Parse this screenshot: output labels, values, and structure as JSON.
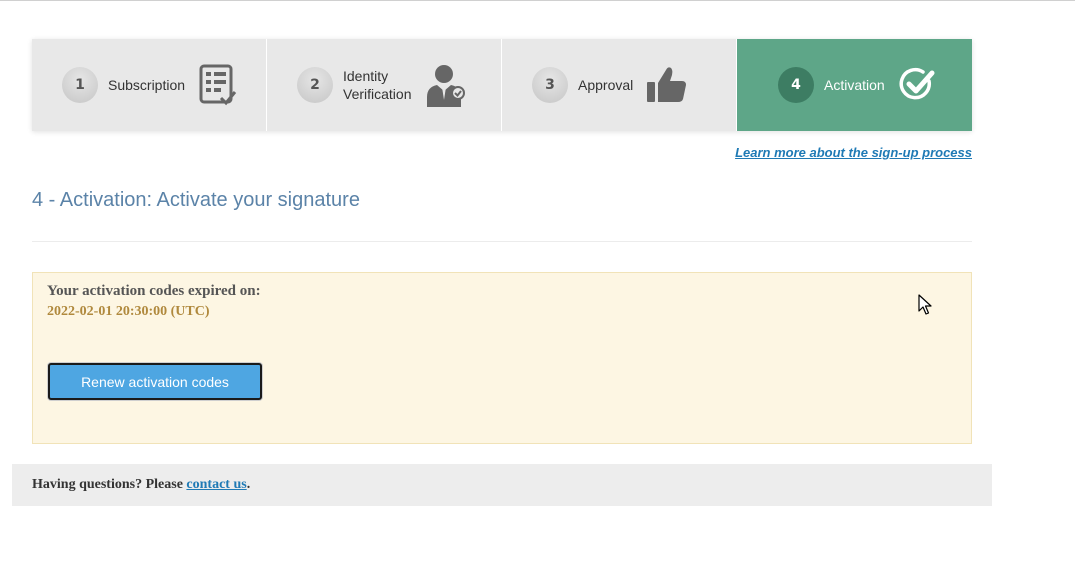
{
  "steps": [
    {
      "number": "1",
      "label": "Subscription",
      "icon": "checklist-icon"
    },
    {
      "number": "2",
      "label_line1": "Identity",
      "label_line2": "Verification",
      "icon": "verified-user-icon"
    },
    {
      "number": "3",
      "label": "Approval",
      "icon": "thumbs-up-icon"
    },
    {
      "number": "4",
      "label": "Activation",
      "icon": "check-circle-icon",
      "active": true
    }
  ],
  "links": {
    "learn_more": "Learn more about the sign-up process"
  },
  "page": {
    "title": "4 - Activation: Activate your signature"
  },
  "notice": {
    "expired_label": "Your activation codes expired on:",
    "expired_date": "2022-02-01 20:30:00 (UTC)",
    "renew_button": "Renew activation codes"
  },
  "footer": {
    "question_prefix": "Having questions? Please ",
    "contact_link": "contact us",
    "question_suffix": "."
  },
  "colors": {
    "active_step": "#5ea688",
    "inactive_step": "#e8e8e8",
    "title": "#5b83a8",
    "link": "#1f7ab5",
    "notice_bg": "#fdf6e3",
    "button": "#4ea6e2"
  }
}
